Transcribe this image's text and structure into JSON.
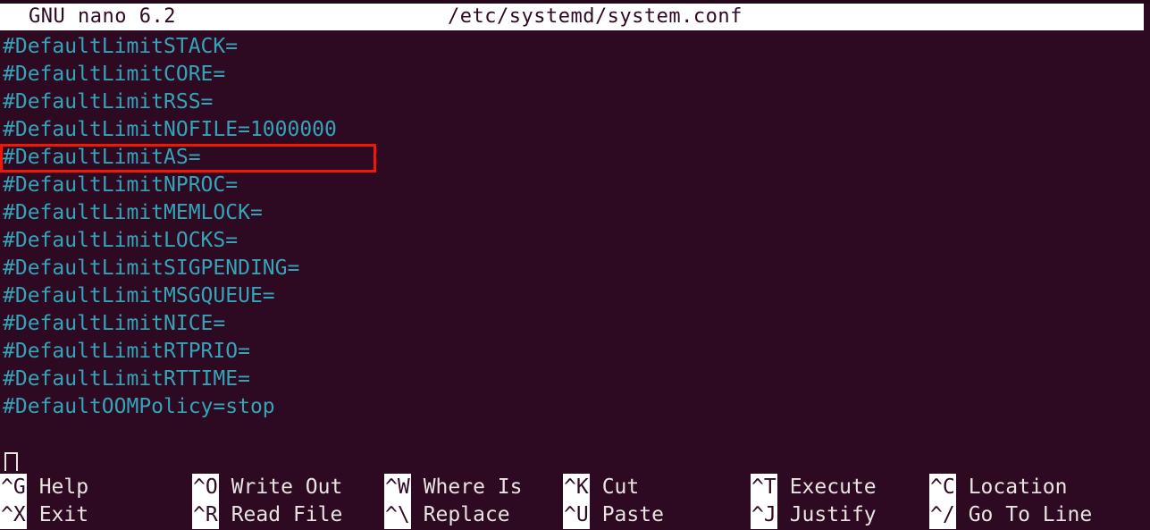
{
  "app": {
    "name": "GNU nano",
    "version_label": "GNU nano 6.2",
    "filename": "/etc/systemd/system.conf"
  },
  "editor": {
    "lines": [
      "#DefaultLimitSTACK=",
      "#DefaultLimitCORE=",
      "#DefaultLimitRSS=",
      "#DefaultLimitNOFILE=1000000",
      "#DefaultLimitAS=",
      "#DefaultLimitNPROC=",
      "#DefaultLimitMEMLOCK=",
      "#DefaultLimitLOCKS=",
      "#DefaultLimitSIGPENDING=",
      "#DefaultLimitMSGQUEUE=",
      "#DefaultLimitNICE=",
      "#DefaultLimitRTPRIO=",
      "#DefaultLimitRTTIME=",
      "#DefaultOOMPolicy=stop"
    ],
    "highlighted_line_index": 3,
    "highlight_color": "#f51505",
    "cursor_line_index": 14,
    "cursor_column": 0
  },
  "colors": {
    "background": "#2d0922",
    "comment_text": "#34a5b8",
    "titlebar_background": "#ffffff",
    "titlebar_text": "#300a24",
    "shortcut_text": "#e8e4e0",
    "shortcut_key_background": "#ffffff",
    "shortcut_key_text": "#300a24",
    "annotation": "#f51505"
  },
  "shortcuts": {
    "row1": [
      {
        "key": "^G",
        "label": "Help"
      },
      {
        "key": "^O",
        "label": "Write Out"
      },
      {
        "key": "^W",
        "label": "Where Is"
      },
      {
        "key": "^K",
        "label": "Cut"
      },
      {
        "key": "^T",
        "label": "Execute"
      },
      {
        "key": "^C",
        "label": "Location"
      }
    ],
    "row2": [
      {
        "key": "^X",
        "label": "Exit"
      },
      {
        "key": "^R",
        "label": "Read File"
      },
      {
        "key": "^\\",
        "label": "Replace"
      },
      {
        "key": "^U",
        "label": "Paste"
      },
      {
        "key": "^J",
        "label": "Justify"
      },
      {
        "key": "^/",
        "label": "Go To Line"
      }
    ]
  }
}
